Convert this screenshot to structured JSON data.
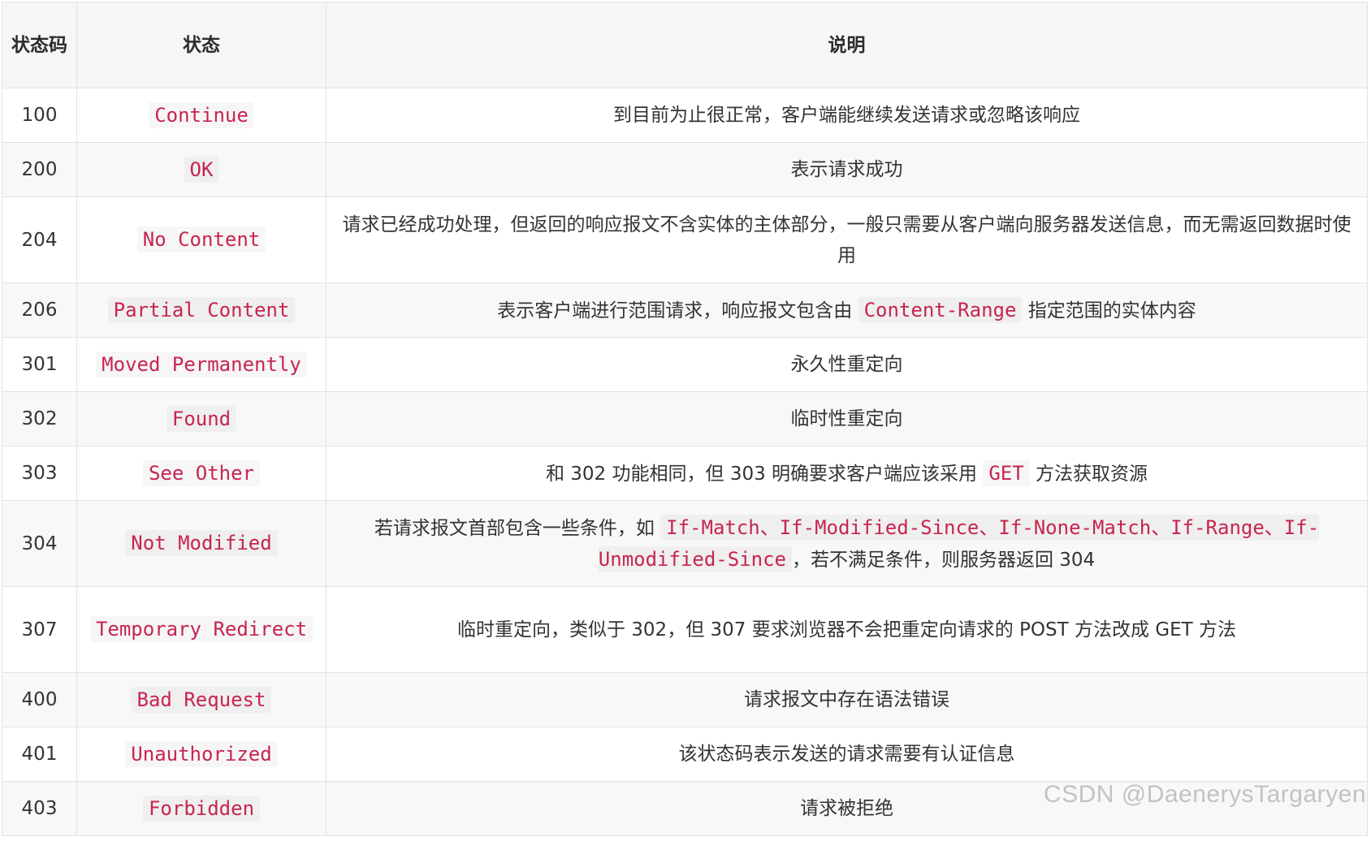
{
  "headers": {
    "code": "状态码",
    "status": "状态",
    "description": "说明"
  },
  "rows": [
    {
      "code": "100",
      "status": "Continue",
      "desc": [
        {
          "t": "text",
          "v": "到目前为止很正常，客户端能继续发送请求或忽略该响应"
        }
      ]
    },
    {
      "code": "200",
      "status": "OK",
      "desc": [
        {
          "t": "text",
          "v": "表示请求成功"
        }
      ]
    },
    {
      "code": "204",
      "status": "No Content",
      "tall": true,
      "desc": [
        {
          "t": "text",
          "v": "请求已经成功处理，但返回的响应报文不含实体的主体部分，一般只需要从客户端向服务器发送信息，而无需返回数据时使用"
        }
      ]
    },
    {
      "code": "206",
      "status": "Partial Content",
      "desc": [
        {
          "t": "text",
          "v": "表示客户端进行范围请求，响应报文包含由 "
        },
        {
          "t": "code",
          "v": "Content-Range"
        },
        {
          "t": "text",
          "v": " 指定范围的实体内容"
        }
      ]
    },
    {
      "code": "301",
      "status": "Moved Permanently",
      "desc": [
        {
          "t": "text",
          "v": "永久性重定向"
        }
      ]
    },
    {
      "code": "302",
      "status": "Found",
      "desc": [
        {
          "t": "text",
          "v": "临时性重定向"
        }
      ]
    },
    {
      "code": "303",
      "status": "See Other",
      "desc": [
        {
          "t": "text",
          "v": "和 302 功能相同，但 303 明确要求客户端应该采用 "
        },
        {
          "t": "code",
          "v": "GET"
        },
        {
          "t": "text",
          "v": " 方法获取资源"
        }
      ]
    },
    {
      "code": "304",
      "status": "Not Modified",
      "tall": true,
      "desc": [
        {
          "t": "text",
          "v": "若请求报文首部包含一些条件，如 "
        },
        {
          "t": "code",
          "v": "If-Match、If-Modified-Since、If-None-Match、If-Range、If-Unmodified-Since"
        },
        {
          "t": "text",
          "v": "，若不满足条件，则服务器返回 304"
        }
      ]
    },
    {
      "code": "307",
      "status": "Temporary Redirect",
      "tall": true,
      "desc": [
        {
          "t": "text",
          "v": "临时重定向，类似于 302，但 307 要求浏览器不会把重定向请求的 POST 方法改成 GET 方法"
        }
      ]
    },
    {
      "code": "400",
      "status": "Bad Request",
      "desc": [
        {
          "t": "text",
          "v": "请求报文中存在语法错误"
        }
      ]
    },
    {
      "code": "401",
      "status": "Unauthorized",
      "desc": [
        {
          "t": "text",
          "v": "该状态码表示发送的请求需要有认证信息"
        }
      ]
    },
    {
      "code": "403",
      "status": "Forbidden",
      "desc": [
        {
          "t": "text",
          "v": "请求被拒绝"
        }
      ]
    }
  ],
  "watermark": "CSDN @DaenerysTargaryen"
}
